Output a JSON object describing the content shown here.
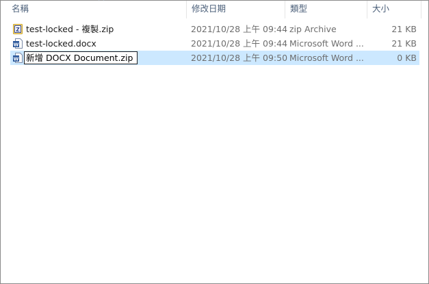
{
  "columns": {
    "name": "名稱",
    "date": "修改日期",
    "type": "類型",
    "size": "大小"
  },
  "files": [
    {
      "icon": "zip-folder-icon",
      "name": "test-locked - 複製.zip",
      "date": "2021/10/28 上午 09:44",
      "type": "zip Archive",
      "size": "21 KB"
    },
    {
      "icon": "word-document-icon",
      "name": "test-locked.docx",
      "date": "2021/10/28 上午 09:44",
      "type": "Microsoft Word ...",
      "size": "21 KB"
    },
    {
      "icon": "word-document-icon",
      "name": "新增 DOCX Document.zip",
      "date": "2021/10/28 上午 09:50",
      "type": "Microsoft Word ...",
      "size": "0 KB",
      "selected": true,
      "renaming": true
    }
  ],
  "colors": {
    "selection": "#cce8ff",
    "header_text": "#4c607a",
    "word_blue": "#2b579a",
    "zip_yellow": "#f4c542"
  }
}
